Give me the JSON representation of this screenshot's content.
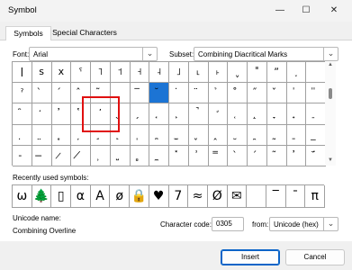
{
  "window": {
    "title": "Symbol",
    "controls": {
      "minimize": "—",
      "maximize": "☐",
      "close": "✕"
    }
  },
  "tabs": [
    {
      "label": "Symbols",
      "active": true
    },
    {
      "label": "Special Characters",
      "active": false
    }
  ],
  "font": {
    "label": "Font:",
    "value": "Arial"
  },
  "subset": {
    "label": "Subset:",
    "value": "Combining Diacritical Marks"
  },
  "grid": {
    "rows": [
      [
        "ǀ",
        "s",
        "x",
        "ˤ",
        "˥",
        "˦",
        "˧",
        "˨",
        "˩",
        "˪",
        "˫",
        "ˬ",
        "˭",
        "ˮ",
        "˯",
        "",
        "",
        ""
      ],
      [
        "ˀ",
        "̀",
        "́",
        "̂",
        "̃",
        "",
        "̅",
        "̆",
        "̇",
        "̈",
        "̉",
        "̊",
        "̋",
        "̌",
        "̍",
        "̎",
        "̏",
        "̐"
      ],
      [
        "̑",
        "̒",
        "̓",
        "̔",
        "̕",
        "̖",
        "̗",
        "̘",
        "̙",
        "̚",
        "̛",
        "̜",
        "̝",
        "̞",
        "̟",
        "̠",
        "̡",
        "̢"
      ],
      [
        "̣",
        "̤",
        "̥",
        "̦",
        "̧",
        "̨",
        "̩",
        "̪",
        "̫",
        "̬",
        "̭",
        "̮",
        "̯",
        "̰",
        "̱",
        "̲",
        "̳",
        "̴"
      ],
      [
        "̵",
        "̶",
        "̷",
        "̸",
        "̹",
        "̺",
        "̻",
        "̼",
        "̽",
        "̾",
        "̿",
        "̀",
        "́",
        "͂",
        "̓",
        "̈́",
        "ͅ",
        "͆"
      ]
    ],
    "selected_index": 23
  },
  "recent": {
    "label": "Recently used symbols:",
    "symbols": [
      "ω",
      "🌲",
      "▯",
      "α",
      "A",
      "ø",
      "🔒",
      "♥",
      "7",
      "≈",
      "Ø",
      "✉",
      "",
      "‾",
      "¯",
      "π"
    ]
  },
  "unicode_name": {
    "label": "Unicode name:",
    "value": "Combining Overline"
  },
  "character_code": {
    "label": "Character code:",
    "value": "0305"
  },
  "from": {
    "label": "from:",
    "value": "Unicode (hex)"
  },
  "buttons": {
    "insert": "Insert",
    "cancel": "Cancel"
  }
}
